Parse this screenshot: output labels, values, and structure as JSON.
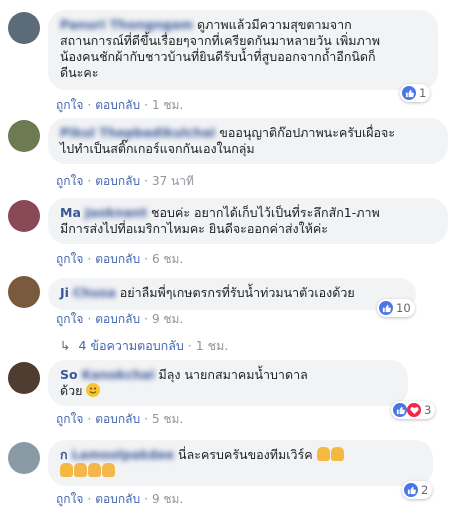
{
  "comments": [
    {
      "name": "Panuri Thongngam",
      "text_lines": [
        "ดูภาพแล้วมีความสุขตามจาก",
        "สถานการณ์ที่ดีขึ้นเรื่อยๆจากที่เครียดกันมาหลายวัน เพิ่มภาพ",
        "น้องคนชักผ้ากับชาวบ้านที่ยินดีรับน้ำที่สูบออกจากถ้ำอีกนิดก็",
        "ดีนะคะ"
      ],
      "like_label": "ถูกใจ",
      "reply_label": "ตอบกลับ",
      "time": "1 ชม.",
      "reaction_count": "1"
    },
    {
      "name": "Pikul Thepbadikulchai",
      "text_lines": [
        "ขออนุญาติก๊อปภาพนะครับเผื่อจะ",
        "ไปทำเป็นสติ๊กเกอร์แจกกันเองในกลุ่ม"
      ],
      "like_label": "ถูกใจ",
      "reply_label": "ตอบกลับ",
      "time": "37 นาที"
    },
    {
      "name_visible": "Ma",
      "name": "Jaoknant",
      "text_lines": [
        "ชอบค่ะ อยากได้เก็บไว้เป็นที่ระลึกสัก1-ภาพ",
        "มีการส่งไปที่อเมริกาไหมคะ ยินดีจะออกค่าส่งให้ค่ะ"
      ],
      "like_label": "ถูกใจ",
      "reply_label": "ตอบกลับ",
      "time": "6 ชม."
    },
    {
      "name_visible": "Ji",
      "name": "Chusa",
      "text_lines": [
        "อย่าลืมพี่ๆเกษตรกรที่รับน้ำท่วมนาตัวเองด้วย"
      ],
      "like_label": "ถูกใจ",
      "reply_label": "ตอบกลับ",
      "time": "9 ชม.",
      "reaction_count": "10",
      "replies_label": "4 ข้อความตอบกลับ",
      "replies_time": "1 ชม."
    },
    {
      "name_visible": "So",
      "name": "Kanokchai",
      "text_lines": [
        "มีลุง นายกสมาคมน้ำบาดาล",
        "ด้วย"
      ],
      "like_label": "ถูกใจ",
      "reply_label": "ตอบกลับ",
      "time": "5 ชม.",
      "reaction_count": "3"
    },
    {
      "name_visible": "ก",
      "name": "Lamoolpakdee",
      "text_lines": [
        "นี่ละครบครันของทีมเวิร์ค"
      ],
      "like_label": "ถูกใจ",
      "reply_label": "ตอบกลับ",
      "time": "9 ชม.",
      "reaction_count": "2"
    }
  ],
  "colors": {
    "link": "#385898",
    "bubble": "#f2f3f5",
    "meta": "#90949c",
    "like": "#4a76e8",
    "love": "#f0284a"
  },
  "icons": [
    "like-icon",
    "love-icon",
    "smile-emoji-icon",
    "thumbs-up-emoji-icon",
    "clap-emoji-icon",
    "reply-arrow-icon"
  ]
}
